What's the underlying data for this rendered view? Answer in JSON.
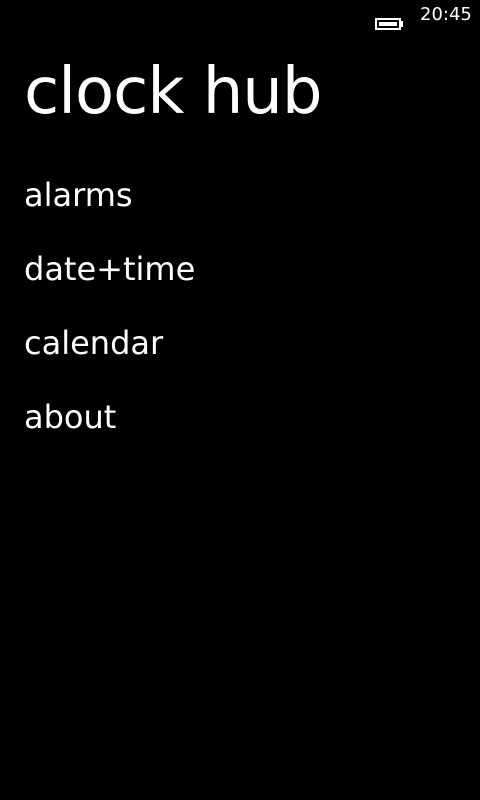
{
  "status_bar": {
    "time": "20:45",
    "battery_icon": "battery-icon",
    "battery_level": 1.0
  },
  "page": {
    "title": "clock hub"
  },
  "menu": {
    "items": [
      {
        "label": "alarms"
      },
      {
        "label": "date+time"
      },
      {
        "label": "calendar"
      },
      {
        "label": "about"
      }
    ]
  },
  "colors": {
    "background": "#000000",
    "text": "#ffffff"
  }
}
